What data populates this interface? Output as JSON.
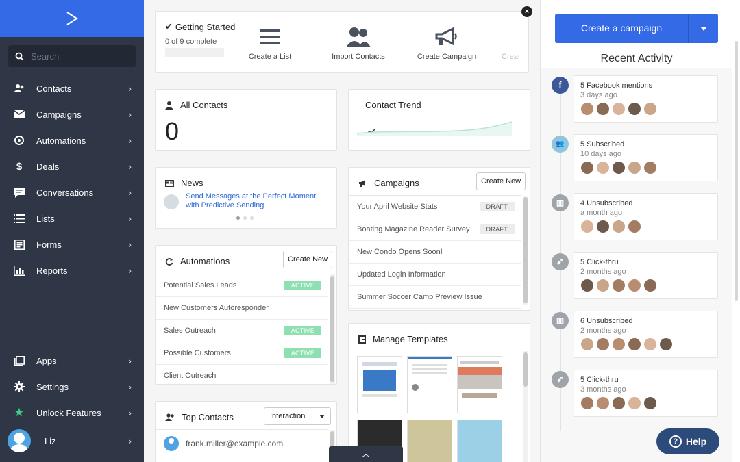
{
  "sidebar": {
    "search_placeholder": "Search",
    "nav": [
      {
        "label": "Contacts",
        "icon": "contacts-icon"
      },
      {
        "label": "Campaigns",
        "icon": "envelope-icon"
      },
      {
        "label": "Automations",
        "icon": "automation-icon"
      },
      {
        "label": "Deals",
        "icon": "dollar-icon"
      },
      {
        "label": "Conversations",
        "icon": "chat-icon"
      },
      {
        "label": "Lists",
        "icon": "list-icon"
      },
      {
        "label": "Forms",
        "icon": "form-icon"
      },
      {
        "label": "Reports",
        "icon": "bar-chart-icon"
      }
    ],
    "bottom_nav": [
      {
        "label": "Apps",
        "icon": "apps-icon"
      },
      {
        "label": "Settings",
        "icon": "gear-icon"
      },
      {
        "label": "Unlock Features",
        "icon": "star-icon"
      }
    ],
    "user": {
      "name": "Liz"
    },
    "chevron": "›"
  },
  "getting_started": {
    "title": "Getting Started",
    "progress_text": "0 of 9 complete",
    "progress": 0,
    "steps": [
      "Create a List",
      "Import Contacts",
      "Create Campaign",
      "Creat"
    ],
    "close": "×"
  },
  "all_contacts": {
    "title": "All Contacts",
    "count": "0"
  },
  "contact_trend": {
    "title": "Contact Trend"
  },
  "news": {
    "title": "News",
    "item": "Send Messages at the Perfect Moment with Predictive Sending"
  },
  "campaigns": {
    "title": "Campaigns",
    "create_new": "Create New",
    "rows": [
      {
        "name": "Your April Website Stats",
        "status": "DRAFT"
      },
      {
        "name": "Boating Magazine Reader Survey",
        "status": "DRAFT"
      },
      {
        "name": "New Condo Opens Soon!",
        "status": ""
      },
      {
        "name": "Updated Login Information",
        "status": ""
      },
      {
        "name": "Summer Soccer Camp Preview Issue",
        "status": ""
      }
    ]
  },
  "automations": {
    "title": "Automations",
    "create_new": "Create New",
    "rows": [
      {
        "name": "Potential Sales Leads",
        "status": "ACTIVE"
      },
      {
        "name": "New Customers Autoresponder",
        "status": ""
      },
      {
        "name": "Sales Outreach",
        "status": "ACTIVE"
      },
      {
        "name": "Possible Customers",
        "status": "ACTIVE"
      },
      {
        "name": "Client Outreach",
        "status": ""
      }
    ]
  },
  "manage_templates": {
    "title": "Manage Templates"
  },
  "top_contacts": {
    "title": "Top Contacts",
    "filter": "Interaction",
    "rows": [
      {
        "email": "frank.miller@example.com"
      }
    ]
  },
  "right_panel": {
    "create_campaign": "Create a campaign",
    "recent_activity_title": "Recent Activity",
    "activities": [
      {
        "title": "5 Facebook mentions",
        "time": "3 days ago",
        "icon": "facebook-icon",
        "icon_color": "#3b5998",
        "faces": 5
      },
      {
        "title": "5 Subscribed",
        "time": "10 days ago",
        "icon": "subscribe-icon",
        "icon_color": "#8fc6dc",
        "faces": 5
      },
      {
        "title": "4 Unsubscribed",
        "time": "a month ago",
        "icon": "unsubscribe-icon",
        "icon_color": "#9fa4ab",
        "faces": 4
      },
      {
        "title": "5 Click-thru",
        "time": "2 months ago",
        "icon": "click-icon",
        "icon_color": "#9fa4ab",
        "faces": 5
      },
      {
        "title": "6 Unsubscribed",
        "time": "2 months ago",
        "icon": "unsubscribe-icon",
        "icon_color": "#9fa4ab",
        "faces": 6
      },
      {
        "title": "5 Click-thru",
        "time": "3 months ago",
        "icon": "click-icon",
        "icon_color": "#9fa4ab",
        "faces": 5
      }
    ]
  },
  "help": {
    "label": "Help"
  },
  "colors": {
    "sidebar_bg": "#2f3747",
    "brand_blue": "#356ae6",
    "active_badge": "#8ee0b0",
    "help_bg": "#2c4a7a"
  }
}
